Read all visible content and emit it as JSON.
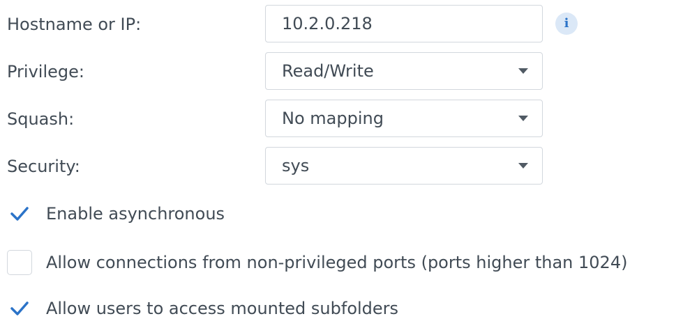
{
  "form": {
    "hostname": {
      "label": "Hostname or IP:",
      "value": "10.2.0.218",
      "info_icon": "info-icon"
    },
    "privilege": {
      "label": "Privilege:",
      "value": "Read/Write"
    },
    "squash": {
      "label": "Squash:",
      "value": "No mapping"
    },
    "security": {
      "label": "Security:",
      "value": "sys"
    }
  },
  "options": [
    {
      "label": "Enable asynchronous",
      "checked": true
    },
    {
      "label": "Allow connections from non-privileged ports (ports higher than 1024)",
      "checked": false
    },
    {
      "label": "Allow users to access mounted subfolders",
      "checked": true
    }
  ],
  "colors": {
    "text": "#414b55",
    "border": "#d2d7dd",
    "accent": "#2b73c8",
    "info_bg": "#dbe8f7"
  }
}
